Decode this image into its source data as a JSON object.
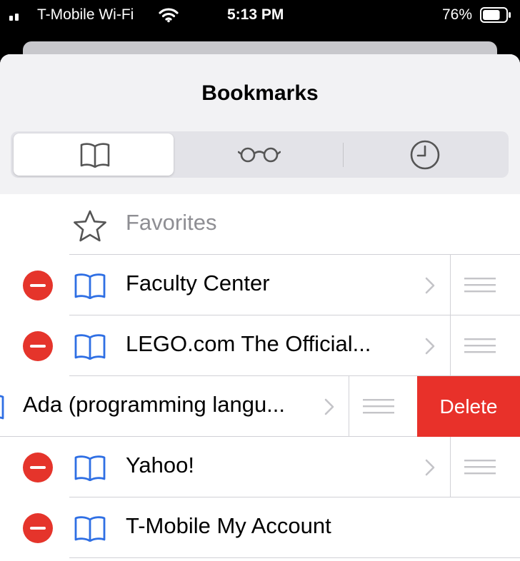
{
  "status": {
    "carrier": "T-Mobile Wi-Fi",
    "time": "5:13 PM",
    "battery": "76%",
    "battery_level": 0.76
  },
  "sheet": {
    "title": "Bookmarks",
    "tabs": [
      {
        "icon": "book-icon",
        "selected": true
      },
      {
        "icon": "reading-list-glasses-icon",
        "selected": false
      },
      {
        "icon": "history-clock-icon",
        "selected": false
      }
    ]
  },
  "favorites": {
    "label": "Favorites",
    "icon": "star-icon"
  },
  "bookmarks": [
    {
      "label": "Faculty Center"
    },
    {
      "label": "LEGO.com The Official..."
    },
    {
      "label": "Ada (programming langu...",
      "swiped": true
    },
    {
      "label": "Yahoo!"
    },
    {
      "label": "T-Mobile My Account"
    }
  ],
  "actions": {
    "delete_label": "Delete"
  },
  "colors": {
    "accent": "#2f6fe4",
    "destructive": "#e8312a",
    "header_bg": "#f2f2f4"
  }
}
